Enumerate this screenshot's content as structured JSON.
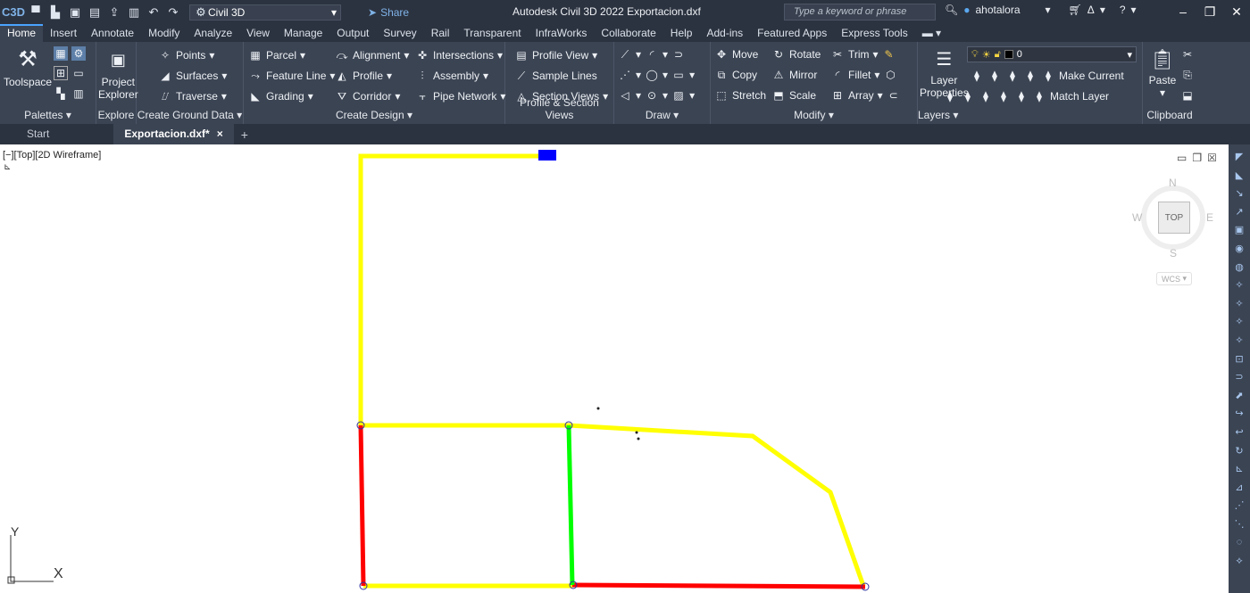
{
  "titlebar": {
    "logo": "C3D",
    "workspace": "Civil 3D",
    "share": "Share",
    "title": "Autodesk Civil 3D 2022   Exportacion.dxf",
    "search_placeholder": "Type a keyword or phrase",
    "user": "ahotalora"
  },
  "ribbon_tabs": [
    "Home",
    "Insert",
    "Annotate",
    "Modify",
    "Analyze",
    "View",
    "Manage",
    "Output",
    "Survey",
    "Rail",
    "Transparent",
    "InfraWorks",
    "Collaborate",
    "Help",
    "Add-ins",
    "Featured Apps",
    "Express Tools"
  ],
  "ribbon": {
    "toolspace": "Toolspace",
    "project_explorer_1": "Project",
    "project_explorer_2": "Explorer",
    "points": "Points",
    "surfaces": "Surfaces",
    "traverse": "Traverse",
    "parcel": "Parcel",
    "feature_line": "Feature Line",
    "grading": "Grading",
    "alignment": "Alignment",
    "profile": "Profile",
    "corridor": "Corridor",
    "intersections": "Intersections",
    "assembly": "Assembly",
    "pipe_network": "Pipe Network",
    "profile_view": "Profile View",
    "sample_lines": "Sample Lines",
    "section_views": "Section Views",
    "move": "Move",
    "rotate": "Rotate",
    "trim": "Trim",
    "copy": "Copy",
    "mirror": "Mirror",
    "fillet": "Fillet",
    "stretch": "Stretch",
    "scale": "Scale",
    "array": "Array",
    "layer_properties_1": "Layer",
    "layer_properties_2": "Properties",
    "layer_current": "0",
    "make_current": "Make Current",
    "match_layer": "Match Layer",
    "paste": "Paste",
    "panels": {
      "palettes": "Palettes",
      "explore": "Explore",
      "create_ground_data": "Create Ground Data",
      "create_design": "Create Design",
      "profile_section_views": "Profile & Section Views",
      "draw": "Draw",
      "modify": "Modify",
      "layers": "Layers",
      "clipboard": "Clipboard"
    }
  },
  "doc_tabs": {
    "start": "Start",
    "active": "Exportacion.dxf*",
    "close": "×",
    "add": "+"
  },
  "viewport": {
    "label": "[−][Top][2D Wireframe]",
    "viewcube_face": "TOP",
    "n": "N",
    "s": "S",
    "e": "E",
    "w": "W",
    "wcs": "WCS",
    "ucs_x": "X",
    "ucs_y": "Y"
  },
  "colors": {
    "yellow_polyline": "#ffff00",
    "red_polyline": "#ff0000",
    "green_polyline": "#00ff00",
    "blue_block": "#0000ff"
  }
}
